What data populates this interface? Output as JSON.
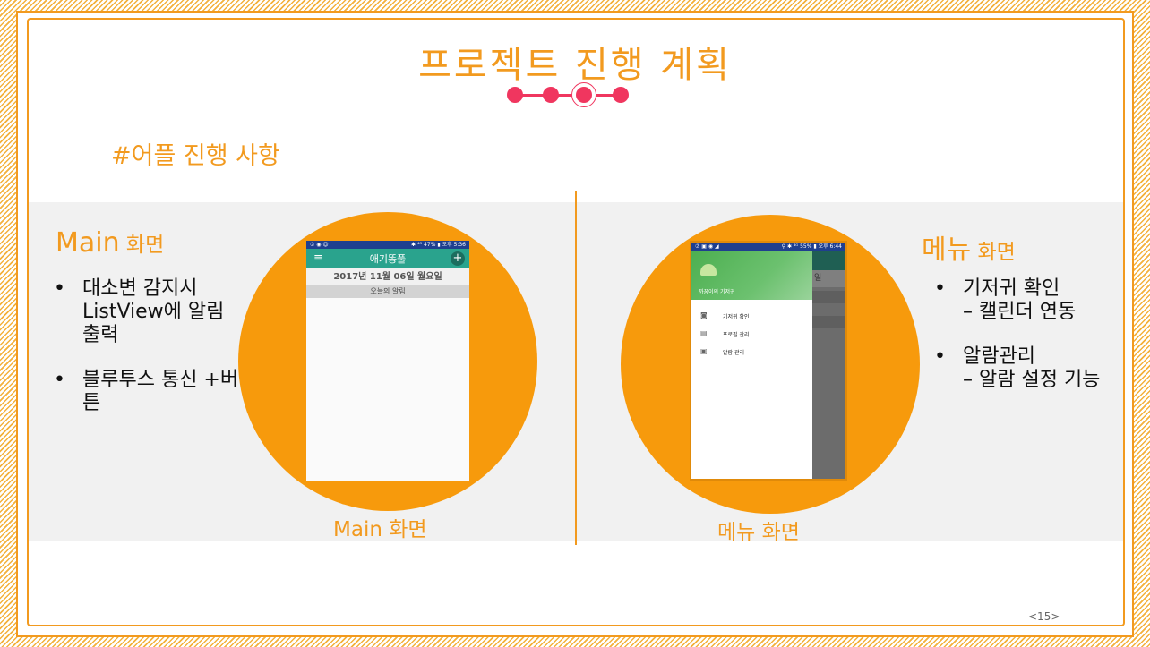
{
  "title": "프로젝트 진행 계획",
  "subtitle": "#어플 진행 사항",
  "left": {
    "heading_main": "Main",
    "heading_sub": " 화면",
    "bullets": [
      "대소변 감지시 ListView에 알림 출력",
      "블루투스 통신 +버튼"
    ],
    "caption": "Main 화면",
    "phone": {
      "status_left": "⑦ ◉ ☺",
      "status_right": "✱ ⁴ᴳ 47% ▮ 오후 5:36",
      "app_title": "애기똥풀",
      "date": "2017년 11월 06일 월요일",
      "alert_header": "오늘의 알림"
    }
  },
  "right": {
    "heading_main": "메뉴",
    "heading_sub": " 화면",
    "bullets": [
      {
        "main": "기저귀 확인",
        "sub": "– 캘린더 연동"
      },
      {
        "main": "알람관리",
        "sub": "– 알람 설정 기능"
      }
    ],
    "caption": "메뉴 화면",
    "phone": {
      "status_left": "⑦ ▣ ◉ ◢",
      "status_right": "⚲ ✱ ⁴ᴳ 55% ▮ 오후 6:44",
      "drawer_name": "까꿍이의 기저귀",
      "drawer_items": [
        "기저귀 확인",
        "프로필 관리",
        "알람 관리"
      ],
      "background_partial": "일"
    }
  },
  "page_number": "<15>",
  "colors": {
    "accent": "#f29a1f",
    "progress": "#f0365f",
    "circle": "#f79a0c",
    "appbar": "#2aa38d",
    "statusbar": "#1f3f8f"
  },
  "progress_dots": {
    "total": 4,
    "current": 3
  }
}
